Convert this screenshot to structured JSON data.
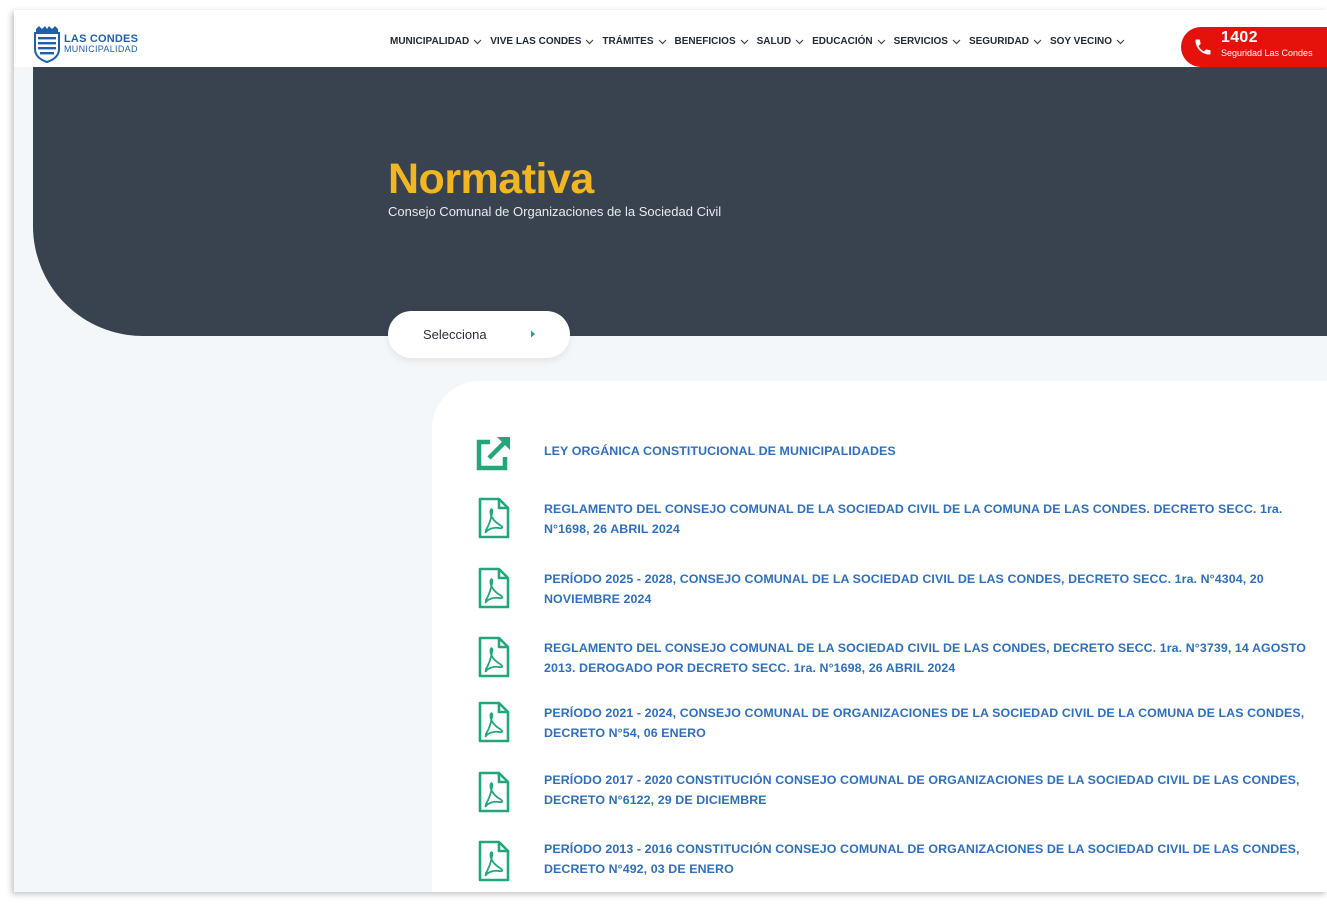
{
  "header": {
    "logo": {
      "line1": "LAS CONDES",
      "line2": "MUNICIPALIDAD"
    },
    "nav": [
      {
        "label": "MUNICIPALIDAD"
      },
      {
        "label": "VIVE LAS CONDES"
      },
      {
        "label": "TRÁMITES"
      },
      {
        "label": "BENEFICIOS"
      },
      {
        "label": "SALUD"
      },
      {
        "label": "EDUCACIÓN"
      },
      {
        "label": "SERVICIOS"
      },
      {
        "label": "SEGURIDAD"
      },
      {
        "label": "SOY VECINO"
      }
    ],
    "emergency": {
      "number": "1402",
      "label": "Seguridad Las Condes"
    }
  },
  "hero": {
    "title": "Normativa",
    "subtitle": "Consejo Comunal de Organizaciones de la Sociedad Civil"
  },
  "selector": {
    "label": "Selecciona"
  },
  "documents": [
    {
      "icon": "external-link-icon",
      "text": "LEY ORGÁNICA CONSTITUCIONAL DE MUNICIPALIDADES"
    },
    {
      "icon": "pdf-file-icon",
      "text": "REGLAMENTO DEL CONSEJO COMUNAL DE LA SOCIEDAD CIVIL DE LA COMUNA DE LAS CONDES. DECRETO SECC. 1ra. N°1698, 26 ABRIL 2024"
    },
    {
      "icon": "pdf-file-icon",
      "text": "PERÍODO 2025 - 2028, CONSEJO COMUNAL DE LA SOCIEDAD CIVIL DE LAS CONDES, DECRETO SECC. 1ra. N°4304, 20 NOVIEMBRE 2024"
    },
    {
      "icon": "pdf-file-icon",
      "text": "REGLAMENTO DEL CONSEJO COMUNAL DE LA SOCIEDAD CIVIL DE LAS CONDES, DECRETO SECC. 1ra. N°3739, 14 AGOSTO 2013. DEROGADO POR DECRETO SECC. 1ra. N°1698, 26 ABRIL 2024"
    },
    {
      "icon": "pdf-file-icon",
      "text": "PERÍODO 2021 - 2024, CONSEJO COMUNAL DE ORGANIZACIONES DE LA SOCIEDAD CIVIL DE LA COMUNA DE LAS CONDES, DECRETO N°54, 06 ENERO"
    },
    {
      "icon": "pdf-file-icon",
      "text": "PERÍODO 2017 - 2020 CONSTITUCIÓN CONSEJO COMUNAL DE ORGANIZACIONES DE LA SOCIEDAD CIVIL DE LAS CONDES, DECRETO N°6122, 29 DE DICIEMBRE"
    },
    {
      "icon": "pdf-file-icon",
      "text": "PERÍODO 2013 - 2016 CONSTITUCIÓN CONSEJO COMUNAL DE ORGANIZACIONES DE LA SOCIEDAD CIVIL DE LAS CONDES, DECRETO N°492, 03 DE ENERO"
    }
  ],
  "colors": {
    "brand_blue": "#1f5fae",
    "hero_bg": "#394350",
    "title_yellow": "#f2b620",
    "emergency_red": "#e5120c",
    "icon_green": "#23a77a",
    "link_blue": "#2f6fc0"
  }
}
